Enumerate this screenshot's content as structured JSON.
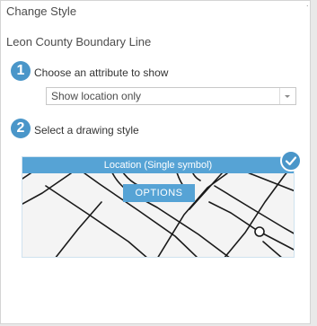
{
  "panel": {
    "title": "Change Style",
    "layer_name": "Leon County Boundary Line"
  },
  "step1": {
    "number": "1",
    "label": "Choose an attribute to show",
    "attribute_select": {
      "value": "Show location only"
    }
  },
  "step2": {
    "number": "2",
    "label": "Select a drawing style",
    "style_card": {
      "title": "Location (Single symbol)",
      "options_label": "OPTIONS",
      "selected": true
    }
  },
  "colors": {
    "accent": "#4a96c9",
    "card_header": "#56a3d5",
    "line_symbol": "#1a1a1a"
  },
  "icons": {
    "check": "check-icon",
    "dropdown": "chevron-down-icon"
  }
}
